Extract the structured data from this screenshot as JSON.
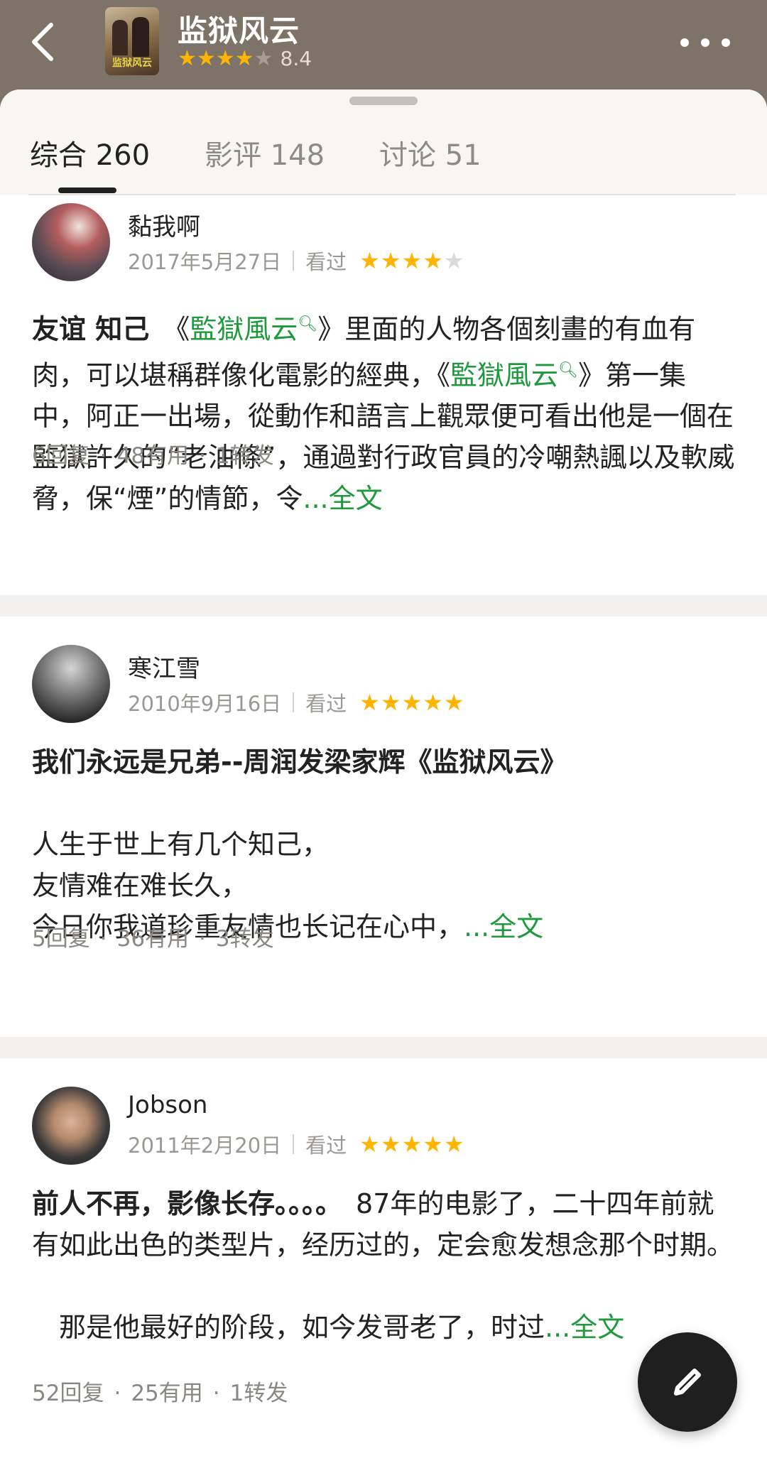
{
  "header": {
    "title": "监狱风云",
    "poster_text": "监狱风云",
    "rating_score": "8.4",
    "rating_stars": 4,
    "icons": {
      "back": "chevron-left-icon",
      "more": "more-dots-icon"
    }
  },
  "tabs": [
    {
      "label": "综合 260",
      "active": true
    },
    {
      "label": "影评 148",
      "active": false
    },
    {
      "label": "讨论 51",
      "active": false
    }
  ],
  "reviews": [
    {
      "username": "黏我啊",
      "date": "2017年5月27日",
      "status": "看过",
      "stars": 4,
      "title": "友谊 知己",
      "body_parts": [
        "《",
        "監獄風云",
        "》里面的人物各個刻畫的有血有肉，可以堪稱群像化電影的經典，《",
        "監獄風云",
        "》第一集中，阿正一出場，從動作和語言上觀眾便可看出他是一個在監獄許久的“老油條”，通過對行政官員的冷嘲熱諷以及軟威脅，保“煙”的情節，令"
      ],
      "more_label": "...全文",
      "replies": "6回复",
      "useful": "48有用",
      "reposts": "1转发"
    },
    {
      "username": "寒江雪",
      "date": "2010年9月16日",
      "status": "看过",
      "stars": 5,
      "title": "我们永远是兄弟--周润发梁家辉《监狱风云》",
      "lines": [
        "人生于世上有几个知己，",
        "友情难在难长久，",
        "今日你我道珍重友情也长记在心中，"
      ],
      "more_label": "...全文",
      "replies": "5回复",
      "useful": "36有用",
      "reposts": "3转发"
    },
    {
      "username": "Jobson",
      "date": "2011年2月20日",
      "status": "看过",
      "stars": 5,
      "title": "前人不再，影像长存。。。。",
      "body": "　87年的电影了，二十四年前就有如此出色的类型片，经历过的，定会愈发想念那个时期。",
      "body2": "　那是他最好的阶段，如今发哥老了，时过",
      "more_label": "...全文",
      "replies": "52回复",
      "useful": "25有用",
      "reposts": "1转发"
    }
  ],
  "fab": {
    "icon": "pencil-icon"
  },
  "colors": {
    "header_bg": "#7d7369",
    "star_on": "#ffb400",
    "link_green": "#1e9a3c",
    "fab_bg": "#1f1f1f"
  }
}
